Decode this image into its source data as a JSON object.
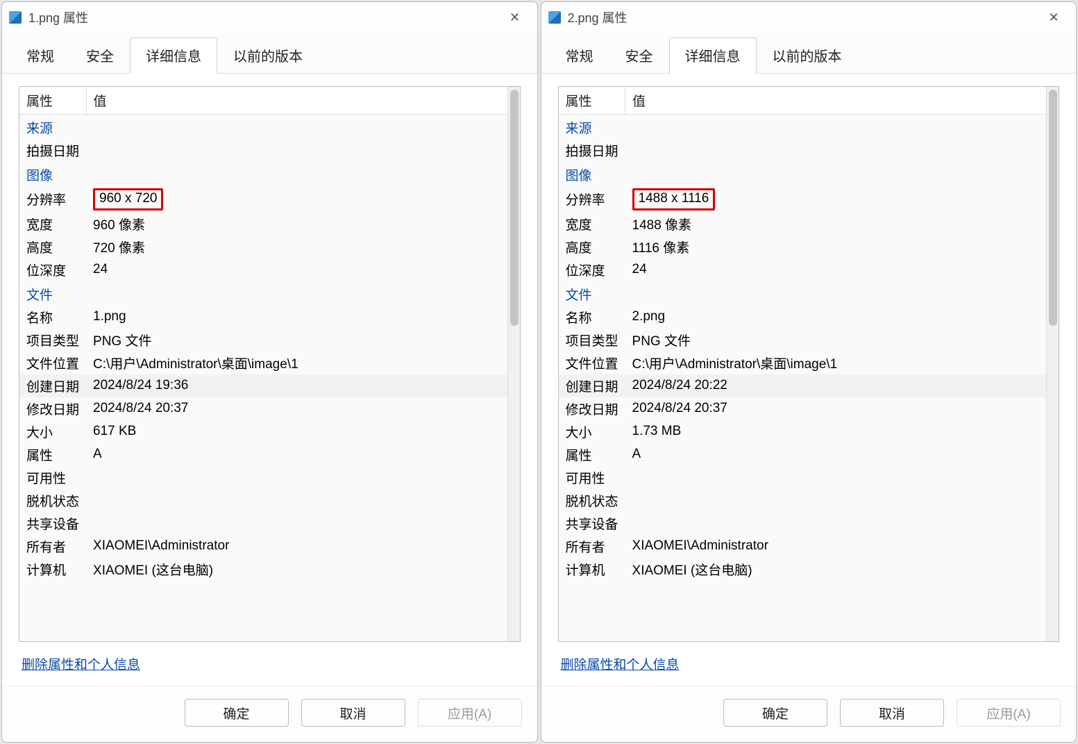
{
  "dialogs": [
    {
      "title": "1.png 属性",
      "tabs": [
        "常规",
        "安全",
        "详细信息",
        "以前的版本"
      ],
      "active_tab_index": 2,
      "header_key": "属性",
      "header_val": "值",
      "sections": {
        "origin": "来源",
        "image": "图像",
        "file": "文件"
      },
      "rows": {
        "shot_date_k": "拍摄日期",
        "shot_date_v": "",
        "res_k": "分辨率",
        "res_v": "960 x 720",
        "width_k": "宽度",
        "width_v": "960 像素",
        "height_k": "高度",
        "height_v": "720 像素",
        "depth_k": "位深度",
        "depth_v": "24",
        "name_k": "名称",
        "name_v": "1.png",
        "type_k": "项目类型",
        "type_v": "PNG 文件",
        "loc_k": "文件位置",
        "loc_v": "C:\\用户\\Administrator\\桌面\\image\\1",
        "created_k": "创建日期",
        "created_v": "2024/8/24 19:36",
        "modified_k": "修改日期",
        "modified_v": "2024/8/24 20:37",
        "size_k": "大小",
        "size_v": "617 KB",
        "attr_k": "属性",
        "attr_v": "A",
        "avail_k": "可用性",
        "avail_v": "",
        "offline_k": "脱机状态",
        "offline_v": "",
        "share_k": "共享设备",
        "share_v": "",
        "owner_k": "所有者",
        "owner_v": "XIAOMEI\\Administrator",
        "computer_k": "计算机",
        "computer_v": "XIAOMEI (这台电脑)"
      },
      "link": "删除属性和个人信息",
      "buttons": {
        "ok": "确定",
        "cancel": "取消",
        "apply": "应用(A)"
      }
    },
    {
      "title": "2.png 属性",
      "tabs": [
        "常规",
        "安全",
        "详细信息",
        "以前的版本"
      ],
      "active_tab_index": 2,
      "header_key": "属性",
      "header_val": "值",
      "sections": {
        "origin": "来源",
        "image": "图像",
        "file": "文件"
      },
      "rows": {
        "shot_date_k": "拍摄日期",
        "shot_date_v": "",
        "res_k": "分辨率",
        "res_v": "1488 x 1116",
        "width_k": "宽度",
        "width_v": "1488 像素",
        "height_k": "高度",
        "height_v": "1116 像素",
        "depth_k": "位深度",
        "depth_v": "24",
        "name_k": "名称",
        "name_v": "2.png",
        "type_k": "项目类型",
        "type_v": "PNG 文件",
        "loc_k": "文件位置",
        "loc_v": "C:\\用户\\Administrator\\桌面\\image\\1",
        "created_k": "创建日期",
        "created_v": "2024/8/24 20:22",
        "modified_k": "修改日期",
        "modified_v": "2024/8/24 20:37",
        "size_k": "大小",
        "size_v": "1.73 MB",
        "attr_k": "属性",
        "attr_v": "A",
        "avail_k": "可用性",
        "avail_v": "",
        "offline_k": "脱机状态",
        "offline_v": "",
        "share_k": "共享设备",
        "share_v": "",
        "owner_k": "所有者",
        "owner_v": "XIAOMEI\\Administrator",
        "computer_k": "计算机",
        "computer_v": "XIAOMEI (这台电脑)"
      },
      "link": "删除属性和个人信息",
      "buttons": {
        "ok": "确定",
        "cancel": "取消",
        "apply": "应用(A)"
      }
    }
  ]
}
